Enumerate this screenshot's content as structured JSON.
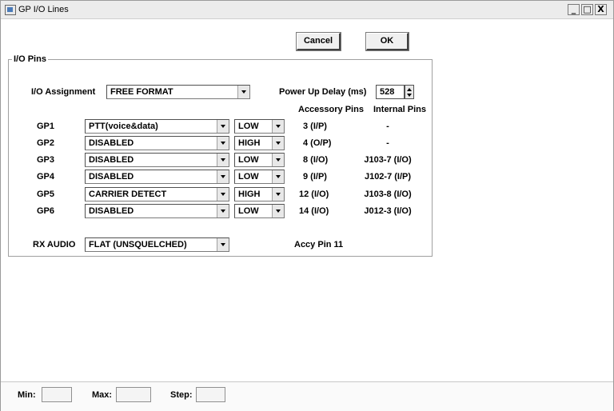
{
  "window": {
    "title": "GP I/O Lines",
    "controls": {
      "minimize": "_",
      "maximize": "□",
      "close": "X"
    }
  },
  "buttons": {
    "cancel": "Cancel",
    "ok": "OK"
  },
  "group": {
    "label": "I/O Pins",
    "io_assignment_label": "I/O Assignment",
    "io_assignment_value": "FREE FORMAT",
    "power_up_delay_label": "Power Up Delay (ms)",
    "power_up_delay_value": "528",
    "col_accessory": "Accessory Pins",
    "col_internal": "Internal Pins"
  },
  "gp_rows": [
    {
      "label": "GP1",
      "function": "PTT(voice&data)",
      "level": "LOW",
      "accessory": "3  (I/P)",
      "internal": "-"
    },
    {
      "label": "GP2",
      "function": "DISABLED",
      "level": "HIGH",
      "accessory": "4  (O/P)",
      "internal": "-"
    },
    {
      "label": "GP3",
      "function": "DISABLED",
      "level": "LOW",
      "accessory": "8  (I/O)",
      "internal": "J103-7 (I/O)"
    },
    {
      "label": "GP4",
      "function": "DISABLED",
      "level": "LOW",
      "accessory": "9  (I/P)",
      "internal": "J102-7 (I/P)"
    },
    {
      "label": "GP5",
      "function": "CARRIER DETECT",
      "level": "HIGH",
      "accessory": "12  (I/O)",
      "internal": "J103-8 (I/O)"
    },
    {
      "label": "GP6",
      "function": "DISABLED",
      "level": "LOW",
      "accessory": "14  (I/O)",
      "internal": "J012-3 (I/O)"
    }
  ],
  "rx_audio": {
    "label": "RX AUDIO",
    "value": "FLAT (UNSQUELCHED)",
    "pin": "Accy Pin 11"
  },
  "status": {
    "min_label": "Min:",
    "max_label": "Max:",
    "step_label": "Step:"
  }
}
